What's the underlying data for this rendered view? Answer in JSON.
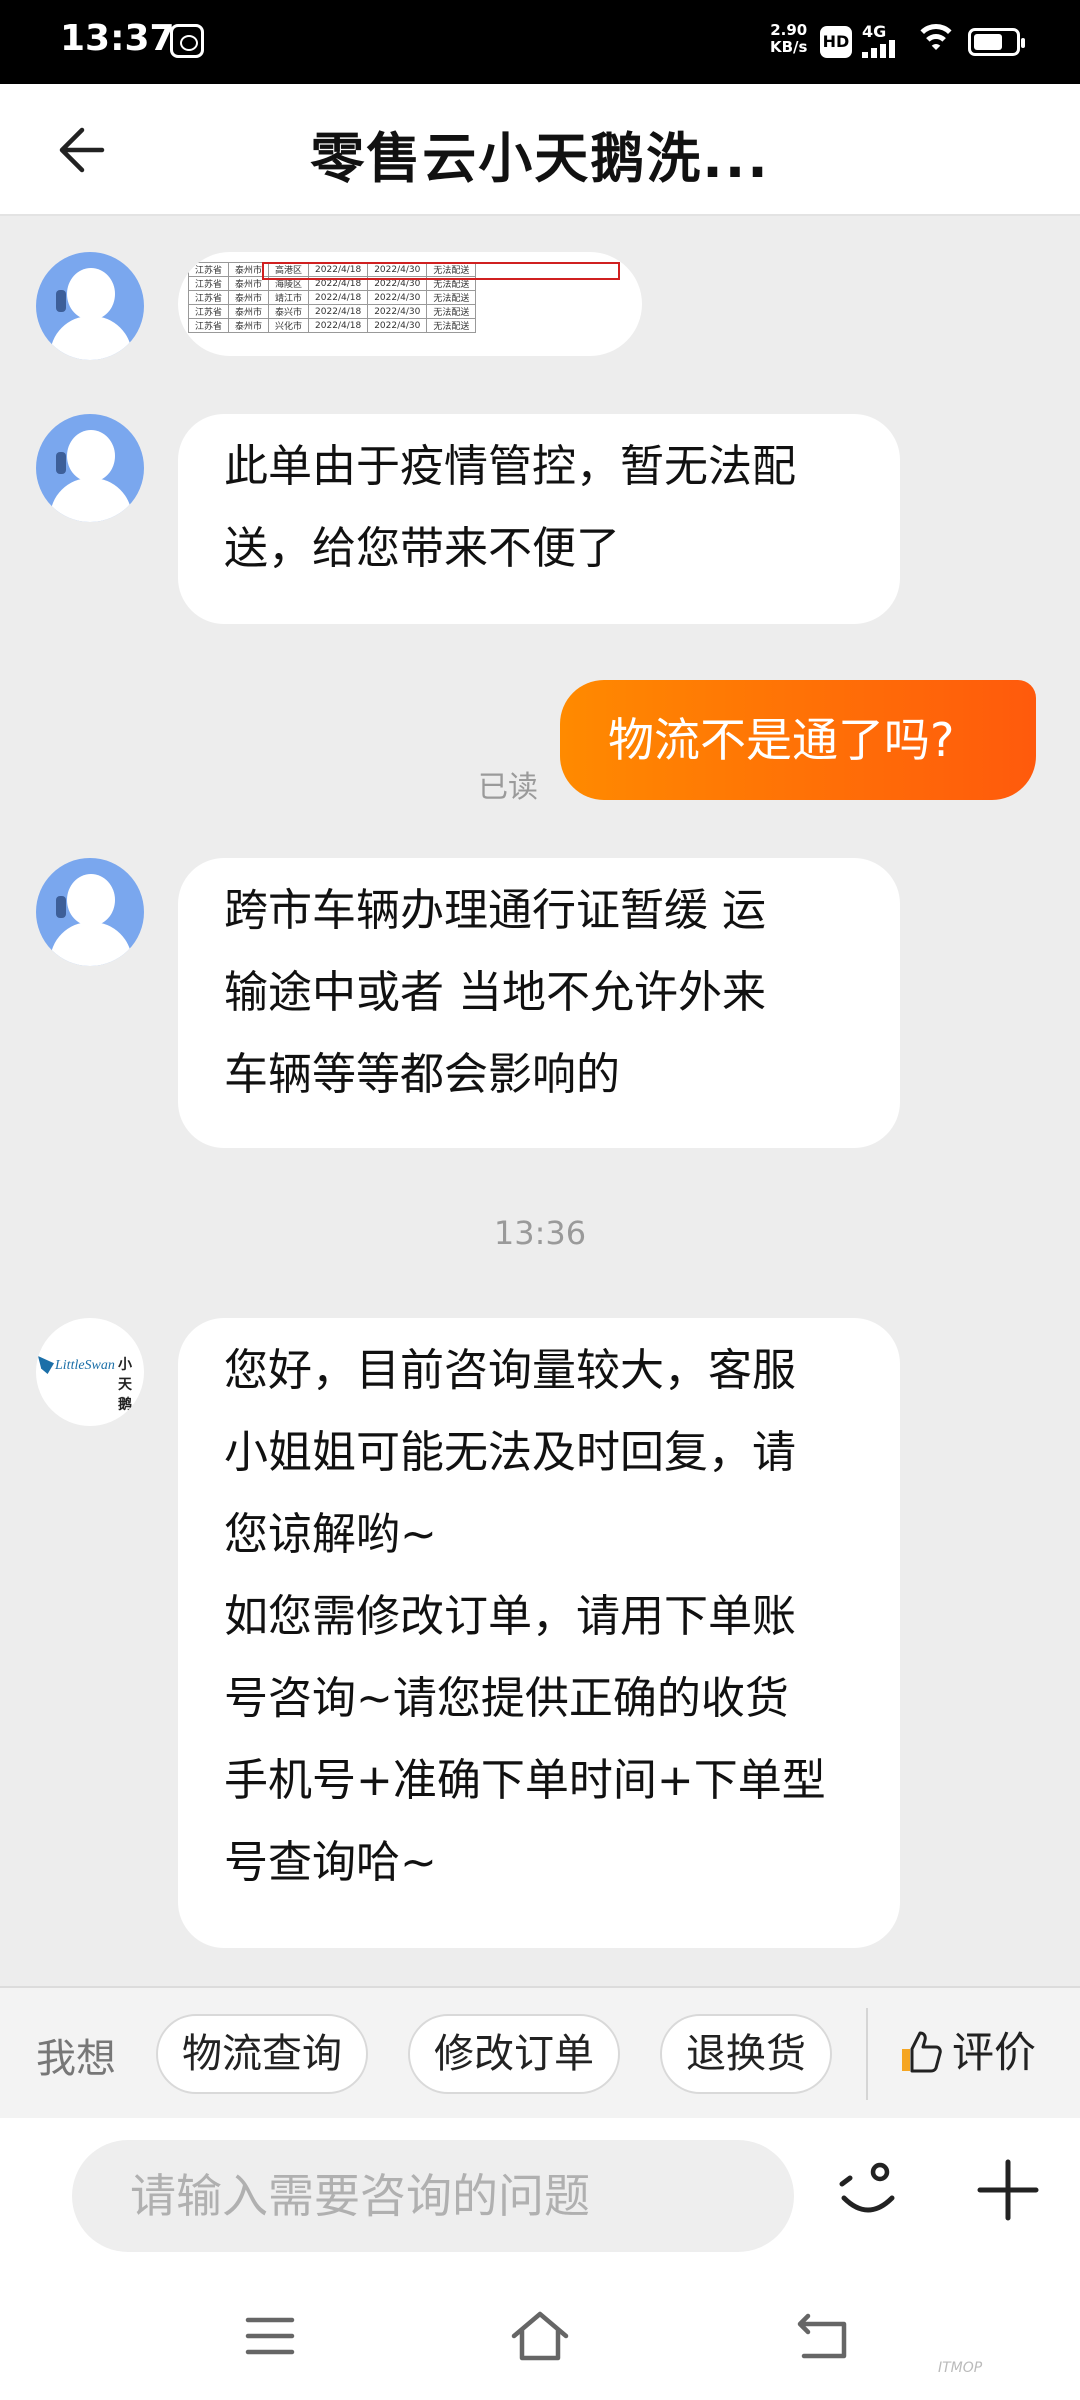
{
  "status_bar": {
    "time": "13:37",
    "net_speed": "2.90",
    "net_speed_unit": "KB/s",
    "hd": "HD",
    "network": "4G"
  },
  "header": {
    "title": "零售云小天鹅洗..."
  },
  "messages": [
    {
      "type": "image",
      "sender": "agent"
    },
    {
      "sender": "agent",
      "lines": [
        "此单由于疫情管控，暂无法配",
        "送，给您带来不便了"
      ]
    },
    {
      "sender": "user",
      "text": "物流不是通了吗?",
      "status": "已读"
    },
    {
      "sender": "agent",
      "lines": [
        "跨市车辆办理通行证暂缓  运",
        "输途中或者  当地不允许外来",
        "车辆等等都会影响的"
      ]
    },
    {
      "type": "time",
      "text": "13:36"
    },
    {
      "sender": "brand",
      "lines": [
        "您好，目前咨询量较大，客服",
        "小姐姐可能无法及时回复，请",
        "您谅解哟~",
        "如您需修改订单，请用下单账",
        "号咨询~请您提供正确的收货",
        "手机号+准确下单时间+下单型",
        "号查询哈~"
      ]
    }
  ],
  "brand_logo": {
    "en": "LittleSwan",
    "cn": "小天鹅"
  },
  "quick_replies": {
    "prefix": "我想",
    "items": [
      "物流查询",
      "修改订单",
      "退换货"
    ],
    "rate": "评价"
  },
  "input": {
    "placeholder": "请输入需要咨询的问题",
    "value": ""
  },
  "image_table": [
    [
      "江苏省",
      "泰州市",
      "高港区",
      "2022/4/18",
      "2022/4/30",
      "无法配送"
    ],
    [
      "江苏省",
      "泰州市",
      "海陵区",
      "2022/4/18",
      "2022/4/30",
      "无法配送"
    ],
    [
      "江苏省",
      "泰州市",
      "靖江市",
      "2022/4/18",
      "2022/4/30",
      "无法配送"
    ],
    [
      "江苏省",
      "泰州市",
      "泰兴市",
      "2022/4/18",
      "2022/4/30",
      "无法配送"
    ],
    [
      "江苏省",
      "泰州市",
      "兴化市",
      "2022/4/18",
      "2022/4/30",
      "无法配送"
    ]
  ],
  "colors": {
    "accent": "#ff7a00",
    "avatar": "#7aa7ee",
    "background": "#ededed"
  }
}
